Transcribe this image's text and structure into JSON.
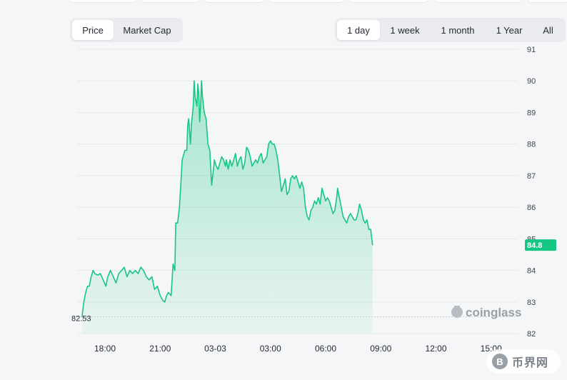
{
  "metric_tabs": [
    {
      "label": "Price",
      "active": true
    },
    {
      "label": "Market Cap",
      "active": false
    }
  ],
  "range_tabs": [
    {
      "label": "1 day",
      "active": true
    },
    {
      "label": "1 week",
      "active": false
    },
    {
      "label": "1 month",
      "active": false
    },
    {
      "label": "1 Year",
      "active": false
    },
    {
      "label": "All",
      "active": false
    }
  ],
  "watermark": "coinglass",
  "site_logo": {
    "symbol": "B",
    "text": "币界网"
  },
  "colors": {
    "line": "#16c784",
    "fill_top": "#16c784",
    "badge": "#16c784",
    "grid": "#e6e8eb",
    "min_line": "#c9ccd1"
  },
  "chart_data": {
    "type": "area",
    "title": "",
    "xlabel": "",
    "ylabel": "",
    "ylim": [
      82,
      91
    ],
    "yticks": [
      82,
      83,
      84,
      85,
      86,
      87,
      88,
      89,
      90,
      91
    ],
    "xlim": [
      16.5,
      32.8
    ],
    "xticks": [
      {
        "value": 18,
        "label": "18:00"
      },
      {
        "value": 21,
        "label": "21:00"
      },
      {
        "value": 24,
        "label": "03-03"
      },
      {
        "value": 27,
        "label": "03:00"
      },
      {
        "value": 30,
        "label": "06:00"
      },
      {
        "value": 33,
        "label": "09:00"
      },
      {
        "value": 36,
        "label": "12:00"
      },
      {
        "value": 39,
        "label": "15:00"
      }
    ],
    "current_value": "84.8",
    "min_value": "82.53",
    "grid": true,
    "series": [
      {
        "values": [
          [
            16.75,
            82.53
          ],
          [
            16.85,
            83.0
          ],
          [
            16.95,
            83.3
          ],
          [
            17.05,
            83.5
          ],
          [
            17.15,
            83.5
          ],
          [
            17.25,
            83.8
          ],
          [
            17.35,
            84.0
          ],
          [
            17.45,
            83.9
          ],
          [
            17.6,
            83.85
          ],
          [
            17.75,
            83.9
          ],
          [
            17.9,
            83.7
          ],
          [
            18.05,
            83.5
          ],
          [
            18.15,
            83.8
          ],
          [
            18.3,
            84.0
          ],
          [
            18.45,
            83.8
          ],
          [
            18.6,
            83.6
          ],
          [
            18.75,
            83.9
          ],
          [
            18.9,
            84.0
          ],
          [
            19.05,
            84.1
          ],
          [
            19.2,
            83.8
          ],
          [
            19.35,
            84.0
          ],
          [
            19.5,
            83.9
          ],
          [
            19.65,
            84.0
          ],
          [
            19.8,
            83.9
          ],
          [
            19.95,
            84.1
          ],
          [
            20.1,
            84.0
          ],
          [
            20.25,
            83.8
          ],
          [
            20.4,
            83.7
          ],
          [
            20.55,
            83.8
          ],
          [
            20.7,
            83.4
          ],
          [
            20.85,
            83.5
          ],
          [
            21.0,
            83.2
          ],
          [
            21.15,
            83.05
          ],
          [
            21.25,
            83.0
          ],
          [
            21.35,
            83.2
          ],
          [
            21.45,
            83.3
          ],
          [
            21.6,
            83.2
          ],
          [
            21.7,
            84.2
          ],
          [
            21.8,
            84.0
          ],
          [
            21.85,
            85.5
          ],
          [
            21.95,
            85.5
          ],
          [
            22.05,
            86.0
          ],
          [
            22.15,
            87.0
          ],
          [
            22.2,
            87.5
          ],
          [
            22.3,
            87.7
          ],
          [
            22.35,
            87.8
          ],
          [
            22.45,
            87.8
          ],
          [
            22.5,
            88.6
          ],
          [
            22.55,
            88.8
          ],
          [
            22.65,
            88.0
          ],
          [
            22.7,
            88.6
          ],
          [
            22.8,
            89.2
          ],
          [
            22.85,
            90.0
          ],
          [
            22.9,
            89.5
          ],
          [
            23.0,
            89.2
          ],
          [
            23.05,
            89.9
          ],
          [
            23.1,
            89.6
          ],
          [
            23.15,
            88.7
          ],
          [
            23.2,
            89.2
          ],
          [
            23.25,
            90.0
          ],
          [
            23.3,
            89.5
          ],
          [
            23.4,
            89.0
          ],
          [
            23.5,
            88.8
          ],
          [
            23.6,
            88.0
          ],
          [
            23.7,
            87.8
          ],
          [
            23.8,
            86.7
          ],
          [
            23.9,
            87.2
          ],
          [
            23.95,
            87.5
          ],
          [
            24.05,
            87.3
          ],
          [
            24.15,
            87.2
          ],
          [
            24.25,
            87.4
          ],
          [
            24.35,
            87.6
          ],
          [
            24.45,
            87.5
          ],
          [
            24.55,
            87.3
          ],
          [
            24.6,
            87.5
          ],
          [
            24.7,
            87.2
          ],
          [
            24.8,
            87.5
          ],
          [
            24.9,
            87.3
          ],
          [
            25.0,
            87.5
          ],
          [
            25.1,
            87.7
          ],
          [
            25.2,
            87.3
          ],
          [
            25.3,
            87.5
          ],
          [
            25.4,
            87.6
          ],
          [
            25.5,
            87.2
          ],
          [
            25.6,
            87.4
          ],
          [
            25.7,
            87.9
          ],
          [
            25.8,
            87.8
          ],
          [
            25.9,
            87.6
          ],
          [
            26.0,
            87.3
          ],
          [
            26.1,
            87.4
          ],
          [
            26.2,
            87.5
          ],
          [
            26.3,
            87.4
          ],
          [
            26.4,
            87.6
          ],
          [
            26.5,
            87.7
          ],
          [
            26.6,
            87.4
          ],
          [
            26.7,
            87.5
          ],
          [
            26.8,
            87.6
          ],
          [
            26.9,
            88.0
          ],
          [
            27.0,
            88.1
          ],
          [
            27.1,
            88.0
          ],
          [
            27.2,
            88.0
          ],
          [
            27.3,
            87.8
          ],
          [
            27.4,
            87.5
          ],
          [
            27.5,
            87.0
          ],
          [
            27.6,
            86.5
          ],
          [
            27.7,
            86.7
          ],
          [
            27.8,
            86.9
          ],
          [
            27.9,
            86.4
          ],
          [
            28.0,
            86.5
          ],
          [
            28.1,
            86.9
          ],
          [
            28.2,
            87.0
          ],
          [
            28.3,
            86.9
          ],
          [
            28.4,
            87.0
          ],
          [
            28.5,
            86.8
          ],
          [
            28.6,
            86.6
          ],
          [
            28.7,
            86.8
          ],
          [
            28.8,
            86.6
          ],
          [
            28.9,
            86.0
          ],
          [
            29.0,
            85.7
          ],
          [
            29.1,
            85.6
          ],
          [
            29.2,
            85.9
          ],
          [
            29.3,
            86.0
          ],
          [
            29.4,
            86.2
          ],
          [
            29.5,
            86.1
          ],
          [
            29.6,
            86.3
          ],
          [
            29.7,
            86.1
          ],
          [
            29.8,
            86.6
          ],
          [
            29.9,
            86.4
          ],
          [
            30.0,
            86.2
          ],
          [
            30.1,
            86.3
          ],
          [
            30.2,
            86.2
          ],
          [
            30.3,
            86.0
          ],
          [
            30.4,
            85.8
          ],
          [
            30.5,
            85.9
          ],
          [
            30.6,
            86.3
          ],
          [
            30.65,
            86.6
          ],
          [
            30.75,
            86.3
          ],
          [
            30.85,
            86.0
          ],
          [
            30.95,
            85.7
          ],
          [
            31.05,
            85.6
          ],
          [
            31.15,
            85.5
          ],
          [
            31.25,
            85.7
          ],
          [
            31.35,
            85.8
          ],
          [
            31.45,
            85.7
          ],
          [
            31.55,
            85.6
          ],
          [
            31.65,
            85.6
          ],
          [
            31.75,
            85.8
          ],
          [
            31.85,
            86.1
          ],
          [
            31.95,
            85.9
          ],
          [
            32.05,
            85.6
          ],
          [
            32.15,
            85.5
          ],
          [
            32.25,
            85.6
          ],
          [
            32.35,
            85.3
          ],
          [
            32.45,
            85.3
          ],
          [
            32.55,
            84.8
          ]
        ]
      }
    ]
  }
}
